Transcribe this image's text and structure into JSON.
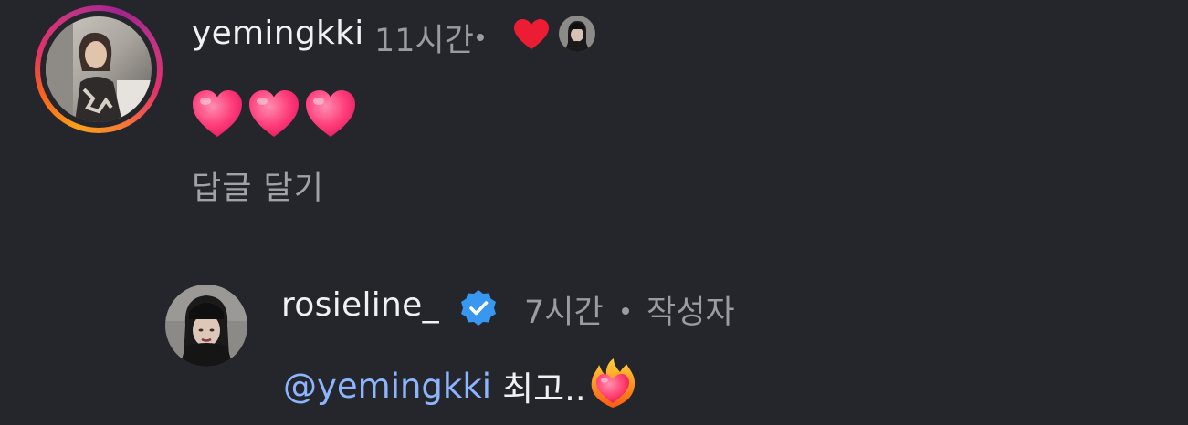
{
  "comment": {
    "username": "yemingkki",
    "time": "11시간",
    "liked_by_author": true,
    "liker_avatar": "author-avatar",
    "body_emoji": [
      "heart",
      "heart",
      "heart"
    ],
    "reply_label": "답글 달기",
    "avatar_story_ring": true
  },
  "reply": {
    "username": "rosieline_",
    "verified": true,
    "time": "7시간",
    "author_label": "작성자",
    "mention": "@yemingkki",
    "body_text": "최고..",
    "body_emoji": "heart-on-fire"
  },
  "colors": {
    "background": "#24262b",
    "username": "#f1f1f3",
    "meta": "#9a9ca3",
    "mention": "#8cb4ff",
    "verified": "#3897f0",
    "like": "#ed1c35"
  }
}
